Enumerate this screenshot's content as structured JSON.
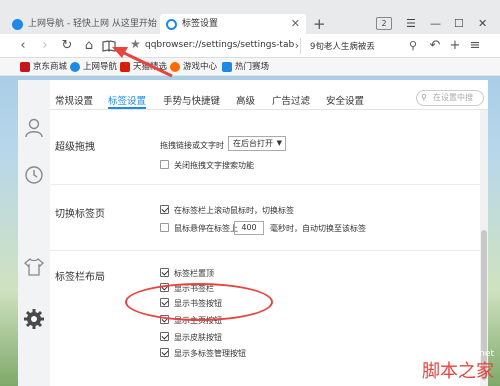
{
  "tabs": [
    {
      "title": "上网导航 - 轻快上网 从这里开始"
    },
    {
      "title": "标签设置"
    }
  ],
  "tab_count": "2",
  "address": {
    "url": "qqbrowser://settings/settings-tab",
    "search_text": "9旬老人生病被丢"
  },
  "bookmarks": [
    {
      "label": "京东商城",
      "color": "#c4161c"
    },
    {
      "label": "上网导航",
      "color": "#1e88e5"
    },
    {
      "label": "天猫精选",
      "color": "#d81e06"
    },
    {
      "label": "游戏中心",
      "color": "#ff6a00"
    },
    {
      "label": "热门赛场",
      "color": "#1e88e5"
    }
  ],
  "settings_tabs": [
    "常规设置",
    "标签设置",
    "手势与快捷键",
    "高级",
    "广告过滤",
    "安全设置"
  ],
  "active_tab": "标签设置",
  "settings_search_placeholder": "在设置中搜",
  "sections": {
    "drag": {
      "title": "超级拖拽",
      "drag_label": "拖拽链接或文字时",
      "drag_option": "在后台打开",
      "disable_label": "关闭拖拽文字搜索功能"
    },
    "switch": {
      "title": "切换标签页",
      "scroll_switch": "在标签栏上滚动鼠标时，切换标签",
      "hover_prefix": "鼠标悬停在标签上",
      "hover_ms": "400",
      "hover_suffix": "毫秒时，自动切换至该标签"
    },
    "layout": {
      "title": "标签栏布局",
      "options": [
        "标签栏置顶",
        "显示书签栏",
        "显示书签按钮",
        "显示主页按钮",
        "显示皮肤按钮",
        "显示多标签管理按钮"
      ]
    }
  },
  "watermark": {
    "site": "jb51.net",
    "name": "脚本之家"
  },
  "colors": {
    "accent": "#1e88e5",
    "annotation": "#e8433e"
  }
}
